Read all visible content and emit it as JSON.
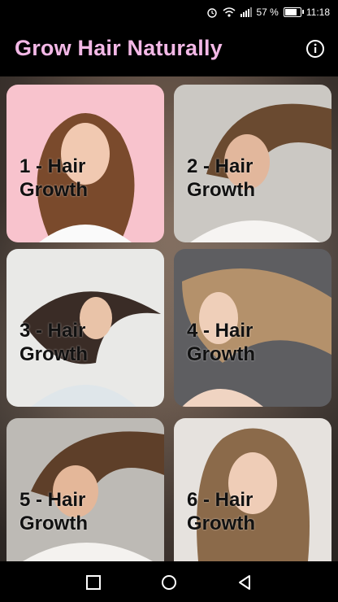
{
  "status_bar": {
    "signal": "57 %",
    "time": "11:18",
    "battery_level": 0.7
  },
  "app_bar": {
    "title": "Grow Hair Naturally",
    "info_icon": "info-icon"
  },
  "cards": [
    {
      "label": "1 - Hair Growth"
    },
    {
      "label": "2 - Hair Growth"
    },
    {
      "label": "3 - Hair Growth"
    },
    {
      "label": "4 - Hair Growth"
    },
    {
      "label": "5 - Hair Growth"
    },
    {
      "label": "6 - Hair Growth"
    }
  ],
  "nav_bar": {
    "recents_icon": "square-icon",
    "home_icon": "circle-icon",
    "back_icon": "triangle-back-icon"
  },
  "colors": {
    "title": "#f3b8e6",
    "card1_bg": "#f8c3cd"
  }
}
